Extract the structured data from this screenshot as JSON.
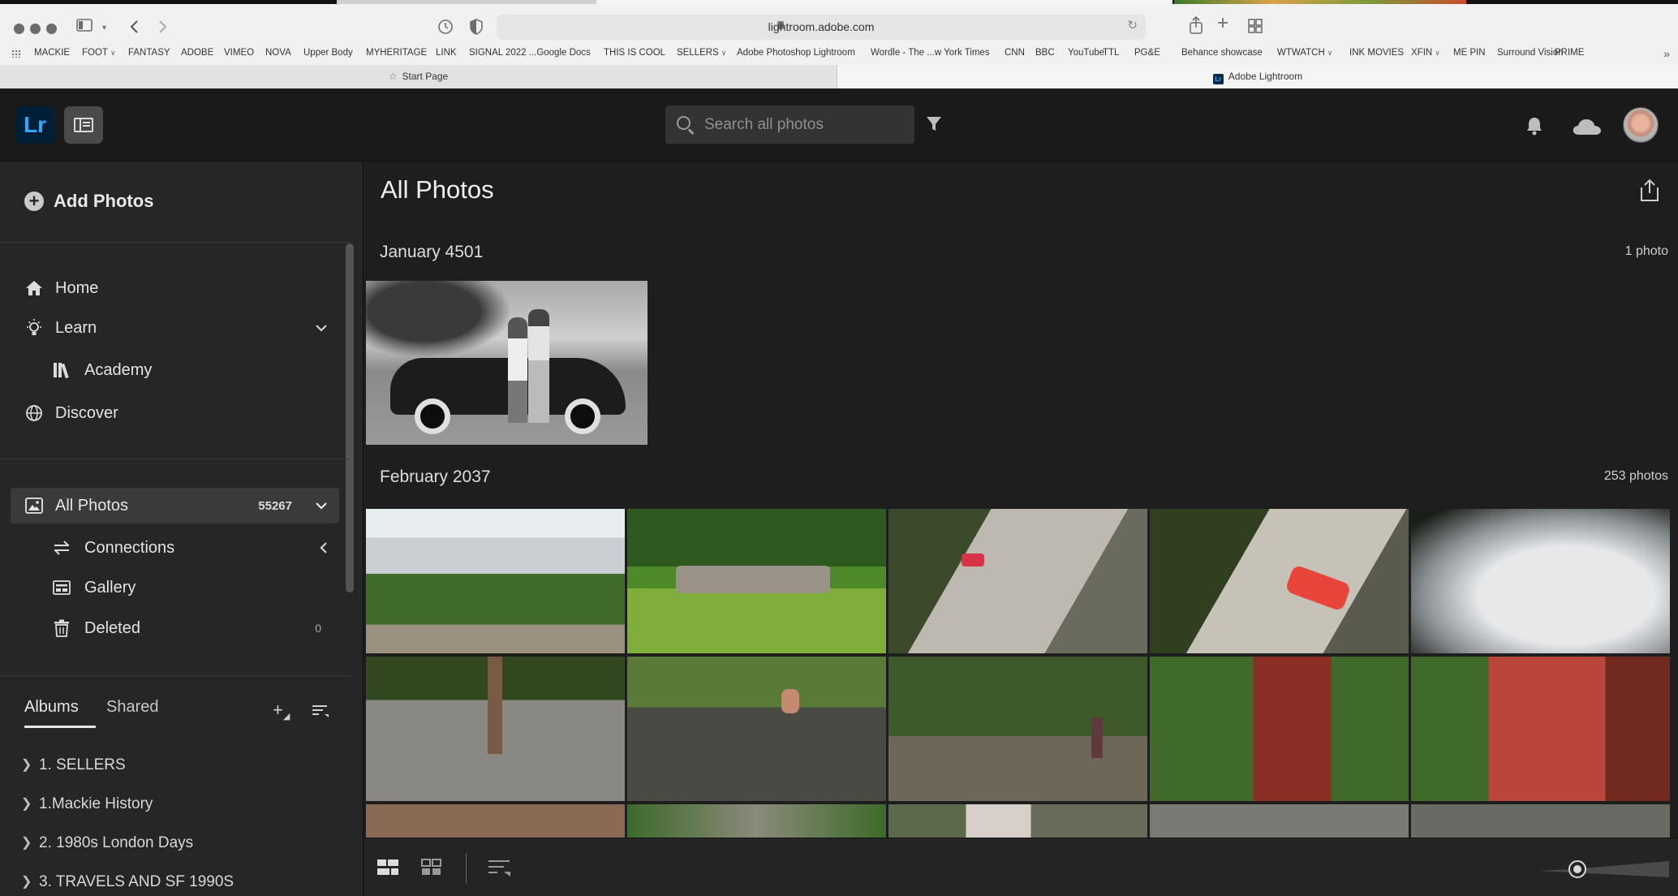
{
  "browser": {
    "url": "lightroom.adobe.com",
    "bookmarks": [
      {
        "label": "MACKIE",
        "menu": false
      },
      {
        "label": "FOOT",
        "menu": true
      },
      {
        "label": "FANTASY",
        "menu": false
      },
      {
        "label": "ADOBE",
        "menu": false
      },
      {
        "label": "VIMEO",
        "menu": false
      },
      {
        "label": "NOVA",
        "menu": false
      },
      {
        "label": "Upper Body",
        "menu": false
      },
      {
        "label": "MYHERITAGE",
        "menu": false
      },
      {
        "label": "LINK",
        "menu": false
      },
      {
        "label": "SIGNAL 2022 ...Google Docs",
        "menu": false
      },
      {
        "label": "THIS IS COOL",
        "menu": false
      },
      {
        "label": "SELLERS",
        "menu": true
      },
      {
        "label": "Adobe Photoshop Lightroom",
        "menu": false
      },
      {
        "label": "Wordle - The ...w York Times",
        "menu": false
      },
      {
        "label": "CNN",
        "menu": false
      },
      {
        "label": "BBC",
        "menu": false
      },
      {
        "label": "YouTube",
        "menu": false
      },
      {
        "label": "TTL",
        "menu": false
      },
      {
        "label": "PG&E",
        "menu": false
      },
      {
        "label": "Behance showcase",
        "menu": false
      },
      {
        "label": "WTWATCH",
        "menu": true
      },
      {
        "label": "INK MOVIES",
        "menu": false
      },
      {
        "label": "XFIN",
        "menu": true
      },
      {
        "label": "ME PIN",
        "menu": false
      },
      {
        "label": "Surround Vision",
        "menu": false
      },
      {
        "label": "PRIME",
        "menu": false
      }
    ],
    "tabs": [
      {
        "label": "Start Page",
        "icon": "star-icon"
      },
      {
        "label": "Adobe Lightroom",
        "icon": "lightroom-favicon-icon"
      }
    ]
  },
  "header": {
    "logo": "Lr",
    "search_placeholder": "Search all photos"
  },
  "sidebar": {
    "add_photos": "Add Photos",
    "nav": {
      "home": "Home",
      "learn": "Learn",
      "academy": "Academy",
      "discover": "Discover",
      "all_photos": "All Photos",
      "all_photos_count": "55267",
      "connections": "Connections",
      "gallery": "Gallery",
      "deleted": "Deleted",
      "deleted_count": "0"
    },
    "albums_tab": "Albums",
    "shared_tab": "Shared",
    "albums": [
      "1. SELLERS",
      "1.Mackie History",
      "2. 1980s London Days",
      "3. TRAVELS AND SF 1990S"
    ]
  },
  "main": {
    "title": "All Photos",
    "sections": [
      {
        "title": "January 4501",
        "count": "1 photo"
      },
      {
        "title": "February 2037",
        "count": "253 photos"
      }
    ]
  },
  "colors": {
    "accent": "#31a8ff",
    "logo_bg": "#001e36",
    "panel_bg": "#262626",
    "main_bg": "#1e1e1e"
  }
}
